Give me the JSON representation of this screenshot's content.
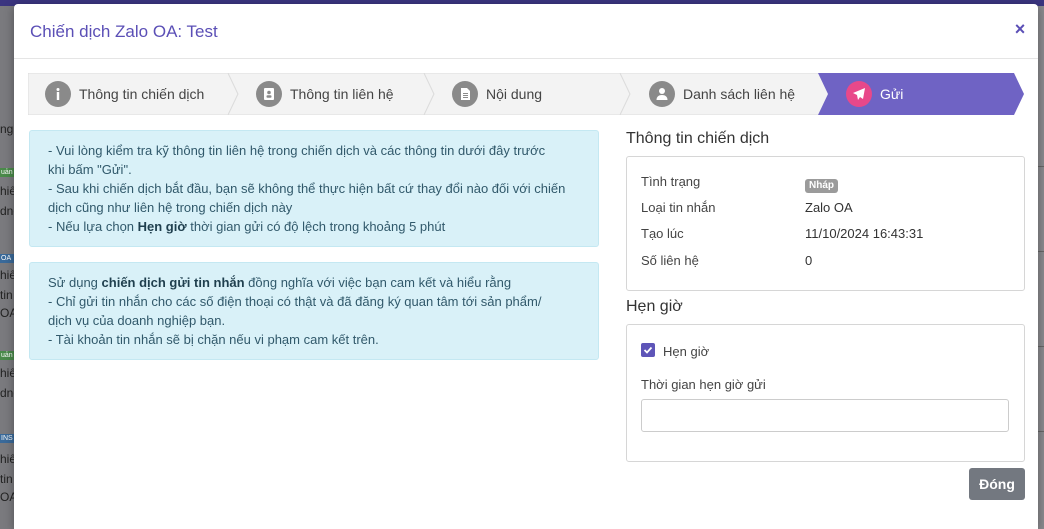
{
  "background": {
    "left_fragments": [
      "ng",
      "hiế",
      "dnơ",
      "hiế",
      "tin",
      "OA",
      "hiế",
      "dnơ",
      "hiế",
      "tin",
      "OA"
    ],
    "left_tags": [
      "uản",
      "OA",
      "uản",
      "INS"
    ]
  },
  "modal": {
    "title": "Chiến dịch Zalo OA: Test",
    "close_symbol": "×"
  },
  "steps": [
    {
      "label": "Thông tin chiến dịch",
      "icon": "info-icon",
      "active": false
    },
    {
      "label": "Thông tin liên hệ",
      "icon": "contact-card-icon",
      "active": false
    },
    {
      "label": "Nội dung",
      "icon": "document-icon",
      "active": false
    },
    {
      "label": "Danh sách liên hệ",
      "icon": "user-icon",
      "active": false
    },
    {
      "label": "Gửi",
      "icon": "send-icon",
      "active": true
    }
  ],
  "notice_1": {
    "line1": "- Vui lòng kiểm tra kỹ thông tin liên hệ trong chiến dịch và các thông tin dưới đây trước",
    "line2": "khi bấm \"Gửi\".",
    "line3": "- Sau khi chiến dịch bắt đầu, bạn sẽ không thể thực hiện bất cứ thay đổi nào đối với chiến",
    "line4": "dịch cũng như liên hệ trong chiến dịch này",
    "line5_prefix": "- Nếu lựa chọn ",
    "line5_bold": "Hẹn giờ",
    "line5_suffix": " thời gian gửi có độ lệch trong khoảng 5 phút"
  },
  "notice_2": {
    "line1_prefix": "Sử dụng ",
    "line1_bold": "chiến dịch gửi tin nhắn",
    "line1_suffix": " đồng nghĩa với việc bạn cam kết và hiểu rằng",
    "line2": "- Chỉ gửi tin nhắn cho các số điện thoại có thật và đã đăng ký quan tâm tới sản phẩm/",
    "line3": "dịch vụ của doanh nghiệp bạn.",
    "line4": "- Tài khoản tin nhắn sẽ bị chặn nếu vi phạm cam kết trên."
  },
  "campaign_info": {
    "title": "Thông tin chiến dịch",
    "rows": [
      {
        "label": "Tình trạng",
        "value": "Nháp",
        "badge": true
      },
      {
        "label": "Loại tin nhắn",
        "value": "Zalo OA",
        "badge": false
      },
      {
        "label": "Tạo lúc",
        "value": "11/10/2024 16:43:31",
        "badge": false
      },
      {
        "label": "Số liên hệ",
        "value": "0",
        "badge": false
      }
    ]
  },
  "schedule": {
    "title": "Hẹn giờ",
    "checkbox_label": "Hẹn giờ",
    "checked": true,
    "time_label": "Thời gian hẹn giờ gửi",
    "time_value": "",
    "time_placeholder": ""
  },
  "footer": {
    "close_label": "Đóng"
  },
  "colors": {
    "accent": "#5b4fb6",
    "active_step": "#6f63c4",
    "active_icon": "#e8488a",
    "alert_bg": "#d9f1f8",
    "close_button": "#737880"
  }
}
